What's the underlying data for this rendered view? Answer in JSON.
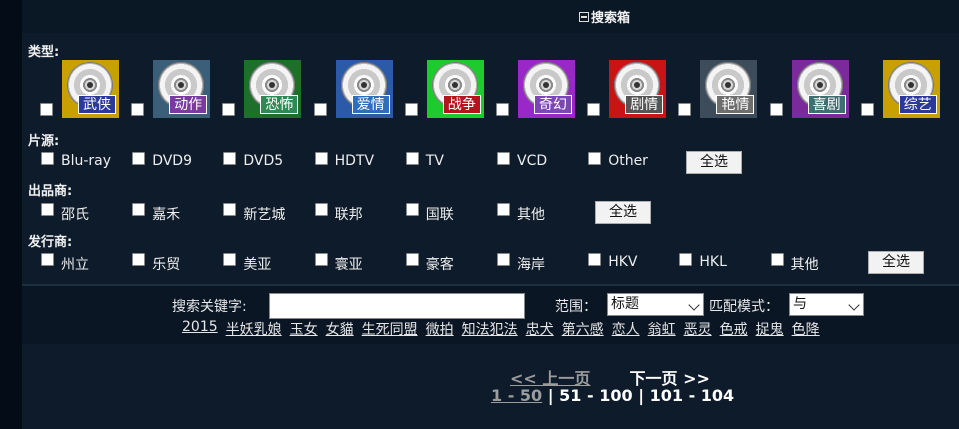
{
  "title": "搜索箱",
  "labels": {
    "type": "类型:",
    "source": "片源:",
    "producer": "出品商:",
    "distributor": "发行商:"
  },
  "genres": [
    {
      "label": "武侠",
      "bg": "#c8a000",
      "tag": "#2b3a9a"
    },
    {
      "label": "动作",
      "bg": "#3b5f78",
      "tag": "#7a3aa0"
    },
    {
      "label": "恐怖",
      "bg": "#1d6f2b",
      "tag": "#2e8a55"
    },
    {
      "label": "爱情",
      "bg": "#2a5aa8",
      "tag": "#2f6dbd"
    },
    {
      "label": "战争",
      "bg": "#1ecb2e",
      "tag": "#b4141e"
    },
    {
      "label": "奇幻",
      "bg": "#9a28c8",
      "tag": "#7b47b5"
    },
    {
      "label": "剧情",
      "bg": "#c81414",
      "tag": "#555555"
    },
    {
      "label": "艳情",
      "bg": "#3c4c5a",
      "tag": "#6e6e6e"
    },
    {
      "label": "喜剧",
      "bg": "#7a2a9a",
      "tag": "#3d7070"
    },
    {
      "label": "综艺",
      "bg": "#c8a000",
      "tag": "#2b3a9a"
    }
  ],
  "sources": [
    "Blu-ray",
    "DVD9",
    "DVD5",
    "HDTV",
    "TV",
    "VCD",
    "Other"
  ],
  "producers": [
    "邵氏",
    "嘉禾",
    "新艺城",
    "联邦",
    "国联",
    "其他"
  ],
  "distributors": [
    "州立",
    "乐贸",
    "美亚",
    "寰亚",
    "豪客",
    "海岸",
    "HKV",
    "HKL",
    "其他"
  ],
  "select_all": "全选",
  "search": {
    "keyword_label": "搜索关键字:",
    "keyword_value": "",
    "scope_label": "范围：",
    "scope_value": "标题",
    "match_label": "匹配模式：",
    "match_value": "与"
  },
  "keywords": [
    "2015",
    "半妖乳娘",
    "玉女",
    "女貓",
    "生死同盟",
    "微拍",
    "知法犯法",
    "忠犬",
    "第六感",
    "恋人",
    "翁虹",
    "恶灵",
    "色戒",
    "捉鬼",
    "色降"
  ],
  "pager": {
    "prev": "<< 上一页",
    "next": "下一页 >>",
    "pages": [
      "1 - 50",
      "51 - 100",
      "101 - 104"
    ],
    "current_index": 0
  }
}
